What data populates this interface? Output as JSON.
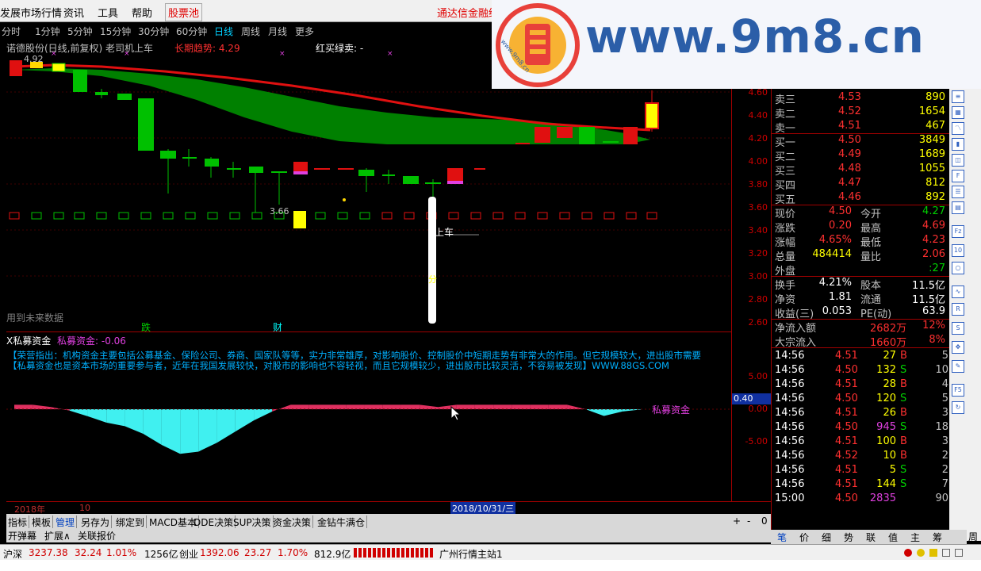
{
  "menubar": {
    "items": [
      "发展市场行情",
      "资讯",
      "工具",
      "帮助"
    ],
    "stockpool": "股票池",
    "promo": "通达信金融终"
  },
  "banner": {
    "text": "www.9m8.cn",
    "small": "www.9m8.cn"
  },
  "periodbar": {
    "items": [
      "分时",
      "1分钟",
      "5分钟",
      "15分钟",
      "30分钟",
      "60分钟",
      "日线",
      "周线",
      "月线",
      "更多"
    ]
  },
  "chart": {
    "title": "诺德股份(日线,前复权) 老司机上车",
    "trend_label": "长期趋势: 4.29",
    "signal_label": "红买绿卖: -",
    "high_label": "4.92",
    "low_label": "3.66",
    "car_label": "上车",
    "fen_label": "分",
    "future_label": "用到未来数据",
    "drop_label": "跌",
    "cai_label": "财",
    "axis_ticks": [
      "4.60",
      "4.40",
      "4.20",
      "4.00",
      "3.80",
      "3.60",
      "3.40",
      "3.20",
      "3.00",
      "2.80",
      "2.60"
    ],
    "accent_red": "#e01010",
    "accent_green": "#00c000"
  },
  "subchart": {
    "title": "X私募资金",
    "value_label": "私募资金: -0.06",
    "desc_line1": "【荣营指出：机构资金主要包括公募基金、保险公司、券商、国家队等等，实力非常雄厚，对影响股价、控制股价中短期走势有非常大的作用。但它规模较大，进出股市需要",
    "desc_line2": "【私募资金也是资本市场的重要参与者，近年在我国发展较快，对股市的影响也不容轻视，而且它规模较少，进出股市比较灵活，不容易被发现】WWW.88GS.COM",
    "series_label": "私募资金",
    "axis_ticks": [
      "5.00",
      "0.00",
      "-5.00"
    ],
    "cursor_value": "0.40",
    "chart_data": {
      "type": "area",
      "series": [
        {
          "name": "私募资金",
          "values": [
            1.0,
            1.0,
            0.5,
            -0.3,
            -1.6,
            -3.0,
            -3.8,
            -5.5,
            -8.0,
            -10.0,
            -9.5,
            -7.5,
            -5.0,
            -2.5,
            -0.5,
            1.0,
            1.0,
            1.0,
            1.0,
            1.0,
            1.0,
            1.0,
            1.0,
            0.5,
            1.0,
            1.0,
            1.0,
            1.0,
            1.0,
            1.0,
            1.0,
            0.0,
            -1.5,
            -0.5,
            -0.06
          ]
        }
      ],
      "ylim": [
        -10,
        6
      ]
    }
  },
  "datebar": {
    "year": "2018年",
    "month": "10",
    "date": "2018/10/31/三"
  },
  "tabs": [
    "指标",
    "模板",
    "管理",
    "另存为",
    "绑定到",
    "MACD基本",
    "DDE决策",
    "SUP决策",
    "资金决策",
    "金钻牛满仓"
  ],
  "tab_controls": [
    "+",
    "-",
    "0"
  ],
  "tabs2": [
    "开弹幕",
    "扩展∧",
    "关联报价"
  ],
  "quote": {
    "asks": [
      {
        "label": "卖三",
        "price": "4.53",
        "vol": "890"
      },
      {
        "label": "卖二",
        "price": "4.52",
        "vol": "1654"
      },
      {
        "label": "卖一",
        "price": "4.51",
        "vol": "467"
      }
    ],
    "bids": [
      {
        "label": "买一",
        "price": "4.50",
        "vol": "3849"
      },
      {
        "label": "买二",
        "price": "4.49",
        "vol": "1689"
      },
      {
        "label": "买三",
        "price": "4.48",
        "vol": "1055"
      },
      {
        "label": "买四",
        "price": "4.47",
        "vol": "812"
      },
      {
        "label": "买五",
        "price": "4.46",
        "vol": "892"
      }
    ],
    "stats": [
      {
        "l1": "现价",
        "v1": "4.50",
        "l2": "今开",
        "v2": "4.27"
      },
      {
        "l1": "涨跌",
        "v1": "0.20",
        "l2": "最高",
        "v2": "4.69"
      },
      {
        "l1": "涨幅",
        "v1": "4.65%",
        "l2": "最低",
        "v2": "4.23"
      },
      {
        "l1": "总量",
        "v1": "484414",
        "l2": "量比",
        "v2": "2.06"
      },
      {
        "l1": "外盘",
        "v1": "",
        "l2": "",
        "v2": ":27"
      }
    ],
    "stats2": [
      {
        "l1": "换手",
        "v1": "4.21%",
        "l2": "股本",
        "v2": "11.5亿"
      },
      {
        "l1": "净资",
        "v1": "1.81",
        "l2": "流通",
        "v2": "11.5亿"
      },
      {
        "l1": "收益(三)",
        "v1": "0.053",
        "l2": "PE(动)",
        "v2": "63.9"
      }
    ],
    "flows": [
      {
        "label": "净流入额",
        "value": "2682万",
        "pct": "12%"
      },
      {
        "label": "大宗流入",
        "value": "1660万",
        "pct": "8%"
      }
    ],
    "ticks": [
      {
        "t": "14:56",
        "p": "4.51",
        "v": "27",
        "s": "B",
        "n": "5"
      },
      {
        "t": "14:56",
        "p": "4.50",
        "v": "132",
        "s": "S",
        "n": "10"
      },
      {
        "t": "14:56",
        "p": "4.51",
        "v": "28",
        "s": "B",
        "n": "4"
      },
      {
        "t": "14:56",
        "p": "4.50",
        "v": "120",
        "s": "S",
        "n": "5"
      },
      {
        "t": "14:56",
        "p": "4.51",
        "v": "26",
        "s": "B",
        "n": "3"
      },
      {
        "t": "14:56",
        "p": "4.50",
        "v": "945",
        "s": "S",
        "n": "18"
      },
      {
        "t": "14:56",
        "p": "4.51",
        "v": "100",
        "s": "B",
        "n": "3"
      },
      {
        "t": "14:56",
        "p": "4.52",
        "v": "10",
        "s": "B",
        "n": "2"
      },
      {
        "t": "14:56",
        "p": "4.51",
        "v": "5",
        "s": "S",
        "n": "2"
      },
      {
        "t": "14:56",
        "p": "4.51",
        "v": "144",
        "s": "S",
        "n": "7"
      },
      {
        "t": "15:00",
        "p": "4.50",
        "v": "2835",
        "s": "",
        "n": "90"
      }
    ]
  },
  "qtabs": [
    "笔",
    "价",
    "细",
    "势",
    "联",
    "值",
    "主",
    "筹"
  ],
  "statusbar": {
    "sh_label": "沪深",
    "sh_value": "3237.38",
    "sh_change": "32.24",
    "sh_pct": "1.01%",
    "sh_amount": "1256亿",
    "cy_label": "创业",
    "cy_value": "1392.06",
    "cy_change": "23.27",
    "cy_pct": "1.70%",
    "cy_amount": "812.9亿",
    "server": "广州行情主站1"
  },
  "right_scroll": [
    "周"
  ]
}
